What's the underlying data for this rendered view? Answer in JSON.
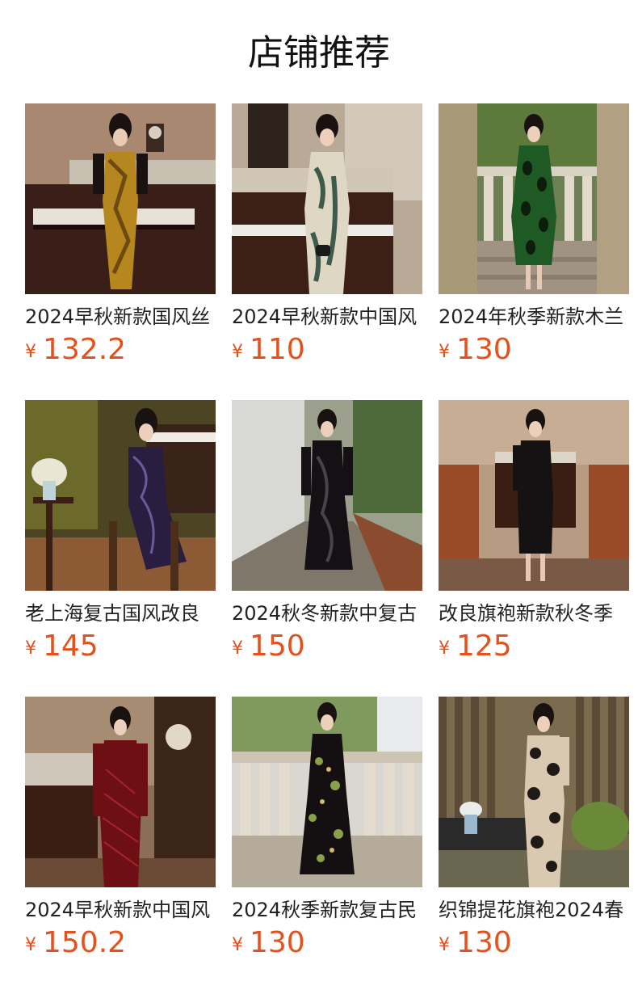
{
  "header": {
    "title": "店铺推荐"
  },
  "currency_symbol": "¥",
  "products": [
    {
      "title": "2024早秋新款国风丝",
      "price": "132.2",
      "image": "gold-floral-velvet-qipao-piano-room"
    },
    {
      "title": "2024早秋新款中国风",
      "price": "110",
      "image": "white-ink-painting-qipao-piano-room"
    },
    {
      "title": "2024年秋季新款木兰",
      "price": "130",
      "image": "green-leaf-print-qipao-garden-balcony"
    },
    {
      "title": "老上海复古国风改良",
      "price": "145",
      "image": "purple-lace-qipao-seated-wooden-chair"
    },
    {
      "title": "2024秋冬新款中复古",
      "price": "150",
      "image": "black-velvet-qipao-garden-path"
    },
    {
      "title": "改良旗袍新款秋冬季",
      "price": "125",
      "image": "black-velvet-qipao-brown-wall-room"
    },
    {
      "title": "2024早秋新款中国风",
      "price": "150.2",
      "image": "burgundy-velvet-qipao-clock-room"
    },
    {
      "title": "2024秋季新款复古民",
      "price": "130",
      "image": "black-floral-velvet-qipao-balustrade"
    },
    {
      "title": "织锦提花旗袍2024春",
      "price": "130",
      "image": "black-beige-brocade-qipao-bamboo-fence"
    }
  ],
  "colors": {
    "price": "#e5511d",
    "title": "#222222",
    "background": "#ffffff"
  }
}
